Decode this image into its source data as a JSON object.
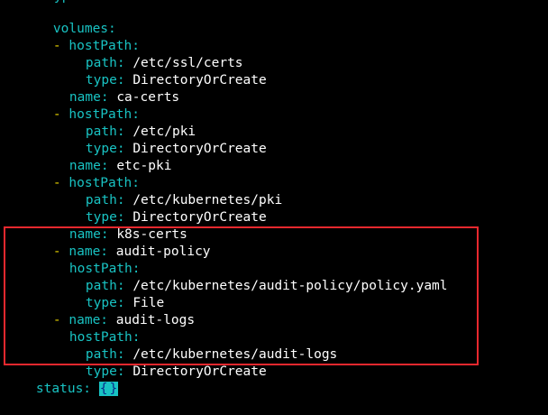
{
  "colors": {
    "background": "#000000",
    "key": "#19c3c3",
    "dash": "#e6d200",
    "value": "#ffffff",
    "highlight_border": "#e8282e"
  },
  "top_partial": "yp",
  "volumes_key": "volumes:",
  "lines": {
    "l1_key": "hostPath:",
    "l2_key": "path:",
    "l2_val": "/etc/ssl/certs",
    "l3_key": "type:",
    "l3_val": "DirectoryOrCreate",
    "l4_key": "name:",
    "l4_val": "ca-certs",
    "l5_key": "hostPath:",
    "l6_key": "path:",
    "l6_val": "/etc/pki",
    "l7_key": "type:",
    "l7_val": "DirectoryOrCreate",
    "l8_key": "name:",
    "l8_val": "etc-pki",
    "l9_key": "hostPath:",
    "l10_key": "path:",
    "l10_val": "/etc/kubernetes/pki",
    "l11_key": "type:",
    "l11_val": "DirectoryOrCreate",
    "l12_key": "name:",
    "l12_val": "k8s-certs",
    "l13_key": "name:",
    "l13_val": "audit-policy",
    "l14_key": "hostPath:",
    "l15_key": "path:",
    "l15_val": "/etc/kubernetes/audit-policy/policy.yaml",
    "l16_key": "type:",
    "l16_val": "File",
    "l17_key": "name:",
    "l17_val": "audit-logs",
    "l18_key": "hostPath:",
    "l19_key": "path:",
    "l19_val": "/etc/kubernetes/audit-logs",
    "l20_key": "type:",
    "l20_val": "DirectoryOrCreate"
  },
  "dash_char": "-",
  "status_key": "status:",
  "status_val_open": "{",
  "status_val_close": "}"
}
